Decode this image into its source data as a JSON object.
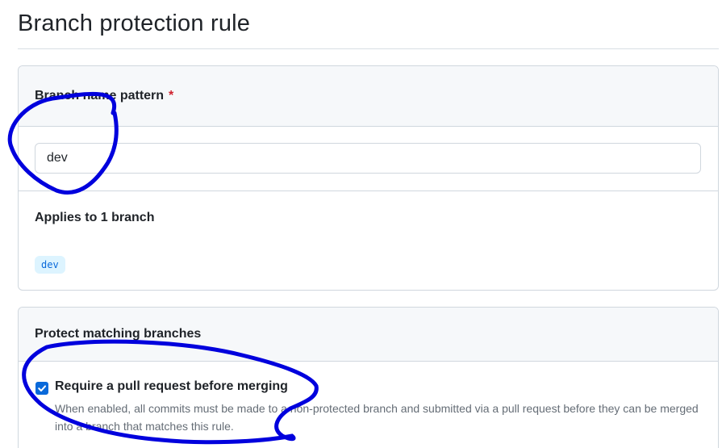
{
  "page": {
    "title": "Branch protection rule"
  },
  "pattern_section": {
    "header": "Branch name pattern",
    "required_marker": "*",
    "input_value": "dev",
    "applies_label": "Applies to 1 branch",
    "matched_branches": [
      "dev"
    ]
  },
  "protect_section": {
    "header": "Protect matching branches",
    "rules": [
      {
        "label": "Require a pull request before merging",
        "checked": true,
        "description": "When enabled, all commits must be made to a non-protected branch and submitted via a pull request before they can be merged into a branch that matches this rule."
      }
    ]
  },
  "colors": {
    "accent": "#0969da",
    "annotation": "#0000dd",
    "required": "#cf222e"
  }
}
